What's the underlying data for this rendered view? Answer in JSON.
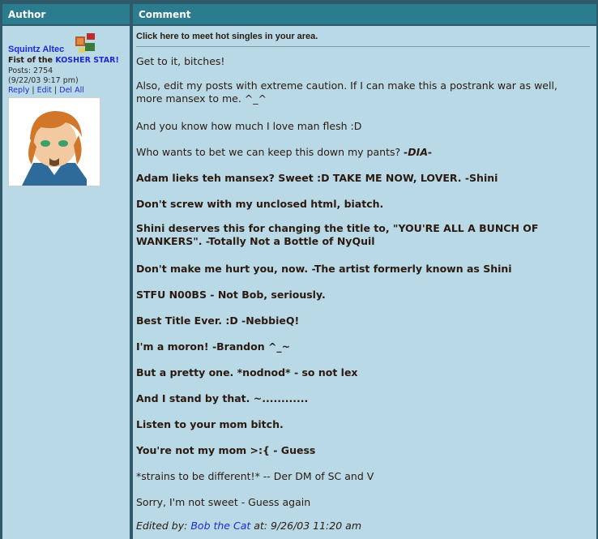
{
  "table": {
    "headers": {
      "author": "Author",
      "comment": "Comment"
    }
  },
  "author": {
    "name": "Squintz Altec",
    "title_prefix": "Fist of the",
    "title_link": "KOSHER STAR!",
    "posts": "Posts: 2754",
    "date": "(9/22/03 9:17 pm)",
    "links": {
      "reply": "Reply",
      "edit": "Edit",
      "del_all": "Del All",
      "sep": "|"
    }
  },
  "comment": {
    "ad": "Click here to meet hot singles in your area.",
    "lines": [
      {
        "text": "Get to it, bitches!",
        "bold": false
      },
      {
        "text": "Also, edit my posts with extreme caution. If I can make this a postrank war as well, more mansex to me. ^_^",
        "bold": false
      },
      {
        "text": "And you know how much I love man flesh :D",
        "bold": false
      },
      {
        "text": "Who wants to bet we can keep this down my pants?",
        "bold": false,
        "suffix": "-DIA-"
      },
      {
        "text": "Adam lieks teh mansex? Sweet :D TAKE ME NOW, LOVER. -Shini",
        "bold": true
      },
      {
        "text": "Don't screw with my unclosed html, biatch.",
        "bold": true
      },
      {
        "text": "Shini deserves this for changing the title to, \"YOU'RE ALL A BUNCH OF WANKERS\". -Totally Not a Bottle of NyQuil",
        "bold": true
      },
      {
        "text": "Don't make me hurt you, now. -The artist formerly known as Shini",
        "bold": true
      },
      {
        "text": "STFU N00BS - Not Bob, seriously.",
        "bold": true
      },
      {
        "text": "Best Title Ever. :D -NebbieQ!",
        "bold": true
      },
      {
        "text": "I'm a moron! -Brandon ^_~",
        "bold": true
      },
      {
        "text": "But a pretty one. *nodnod* - so not lex",
        "bold": true
      },
      {
        "text": "And I stand by that. ~............",
        "bold": true
      },
      {
        "text": "Listen to your mom bitch.",
        "bold": true
      },
      {
        "text": "You're not my mom >:{ - Guess",
        "bold": true
      },
      {
        "text": "*strains to be different!* -- Der DM of SC and V",
        "bold": false
      },
      {
        "text": "Sorry, I'm not sweet - Guess again",
        "bold": false
      }
    ],
    "edited": {
      "prefix": "Edited by:",
      "user": "Bob the Cat",
      "suffix": "at: 9/26/03 11:20 am"
    }
  }
}
